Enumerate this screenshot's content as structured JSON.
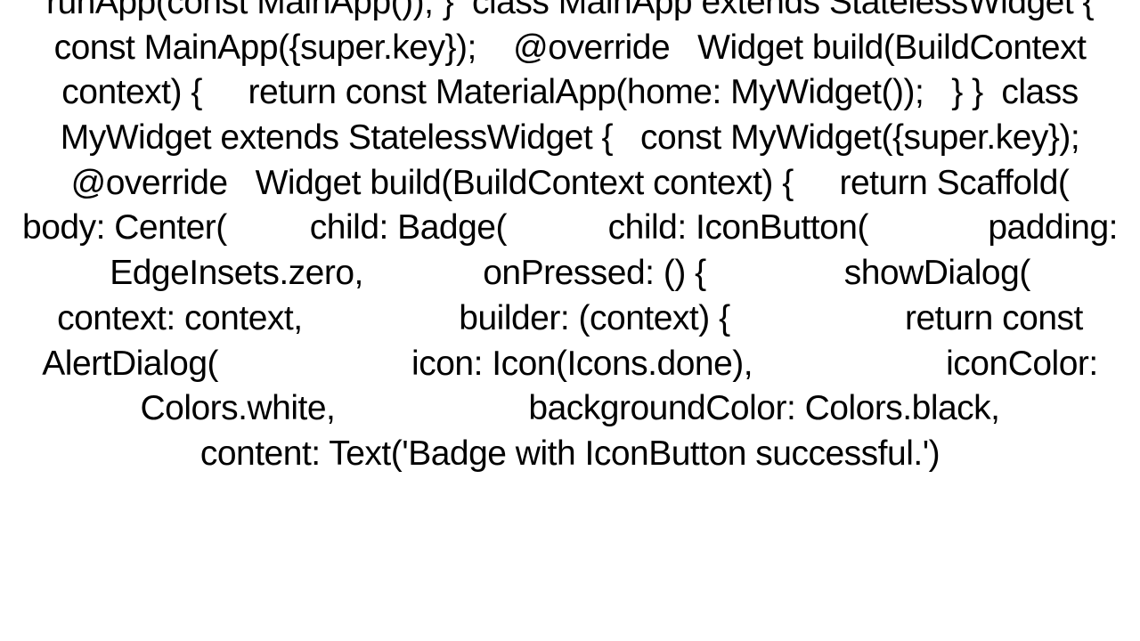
{
  "code": {
    "content": "runApp(const MainApp()); }  class MainApp extends StatelessWidget {   const MainApp({super.key});    @override   Widget build(BuildContext context) {     return const MaterialApp(home: MyWidget());   } }  class MyWidget extends StatelessWidget {   const MyWidget({super.key});    @override   Widget build(BuildContext context) {     return Scaffold(       body: Center(         child: Badge(           child: IconButton(             padding: EdgeInsets.zero,             onPressed: () {               showDialog(                 context: context,                 builder: (context) {                   return const AlertDialog(                     icon: Icon(Icons.done),                     iconColor: Colors.white,                     backgroundColor: Colors.black,                     content: Text('Badge with IconButton successful.')"
  }
}
